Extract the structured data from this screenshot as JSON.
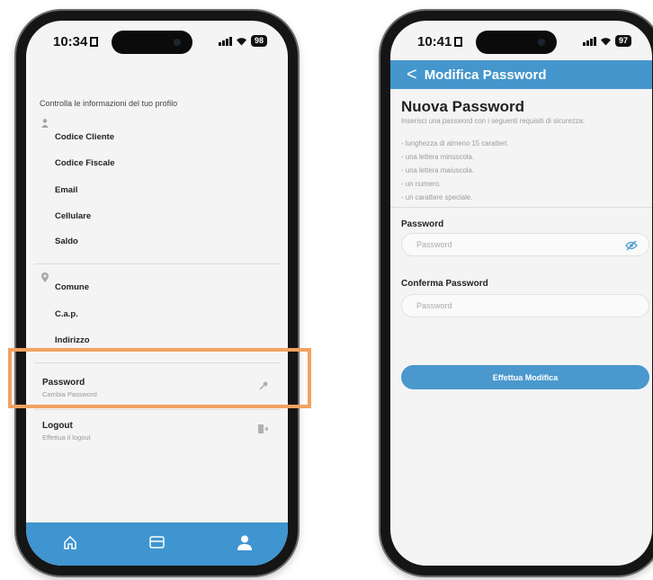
{
  "colors": {
    "accent": "#4496cc",
    "highlight": "#f0a260",
    "screen_bg": "#f4f4f4"
  },
  "left_phone": {
    "status": {
      "time": "10:34",
      "battery": "98"
    },
    "intro": "Controlla le informazioni del tuo profilo",
    "profile_fields": [
      {
        "label": "Codice Cliente",
        "icon": "user-icon"
      },
      {
        "label": "Codice Fiscale"
      },
      {
        "label": "Email"
      },
      {
        "label": "Cellulare"
      },
      {
        "label": "Saldo"
      }
    ],
    "address_fields": [
      {
        "label": "Comune",
        "icon": "location-pin-icon"
      },
      {
        "label": "C.a.p."
      },
      {
        "label": "Indirizzo"
      }
    ],
    "password_row": {
      "title": "Password",
      "subtitle": "Cambia Password",
      "icon": "key-icon"
    },
    "logout_row": {
      "title": "Logout",
      "subtitle": "Effettua il logout",
      "icon": "logout-icon"
    },
    "nav": [
      {
        "name": "home",
        "icon": "home-icon"
      },
      {
        "name": "card",
        "icon": "card-icon"
      },
      {
        "name": "profile",
        "icon": "profile-icon",
        "active": true
      }
    ]
  },
  "right_phone": {
    "status": {
      "time": "10:41",
      "battery": "97"
    },
    "header": {
      "back": "<",
      "title": "Modifica Password"
    },
    "section_title": "Nuova Password",
    "requirements": [
      "Inserisci una password con i seguenti requisiti di sicurezza:",
      "- lunghezza di almeno 15 caratteri.",
      "- una lettera minuscola.",
      "- una lettera maiuscola.",
      "- un numero.",
      "- un carattere speciale."
    ],
    "password_label": "Password",
    "password_placeholder": "Password",
    "confirm_label": "Conferma Password",
    "confirm_placeholder": "Password",
    "submit_label": "Effettua Modifica"
  }
}
